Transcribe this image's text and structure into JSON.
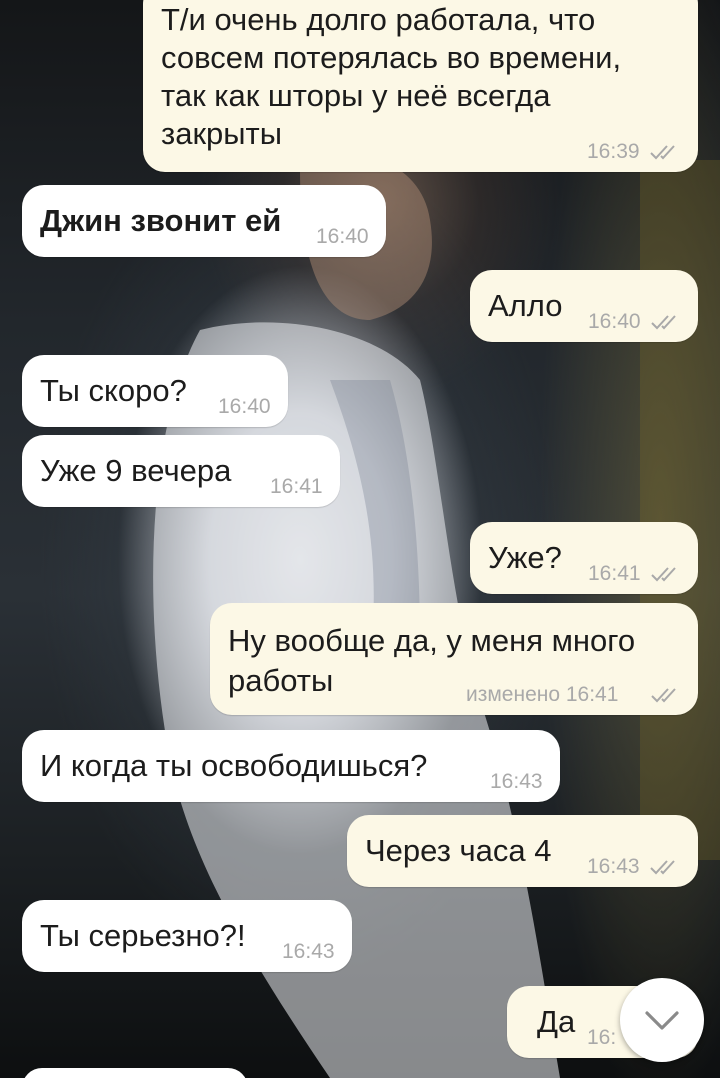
{
  "messages": [
    {
      "dir": "out",
      "text_lines": [
        "Т/и очень долго работала, что",
        "совсем потерялась во времени,",
        "так как шторы у неё всегда",
        "закрыты"
      ],
      "time": "16:39",
      "status": "read"
    },
    {
      "dir": "in",
      "text": "Джин звонит ей",
      "time": "16:40"
    },
    {
      "dir": "out",
      "text": "Алло",
      "time": "16:40",
      "status": "read"
    },
    {
      "dir": "in",
      "text": "Ты скоро?",
      "time": "16:40"
    },
    {
      "dir": "in",
      "text": "Уже 9 вечера",
      "time": "16:41"
    },
    {
      "dir": "out",
      "text": "Уже?",
      "time": "16:41",
      "status": "read"
    },
    {
      "dir": "out",
      "text_lines": [
        "Ну вообще да, у меня много",
        "работы"
      ],
      "time": "изменено 16:41",
      "status": "read"
    },
    {
      "dir": "in",
      "text": "И когда ты освободишься?",
      "time": "16:43"
    },
    {
      "dir": "out",
      "text": "Через часа 4",
      "time": "16:43",
      "status": "read"
    },
    {
      "dir": "in",
      "text": "Ты серьезно?!",
      "time": "16:43"
    },
    {
      "dir": "out",
      "text": "Да",
      "time": "16:",
      "status": "read"
    }
  ],
  "scroll_button": {
    "icon": "chevron-down-icon"
  },
  "colors": {
    "incoming": "#ffffff",
    "outgoing": "#fcf8e6",
    "time": "#a9a9a9",
    "check": "#a9a9a9"
  }
}
